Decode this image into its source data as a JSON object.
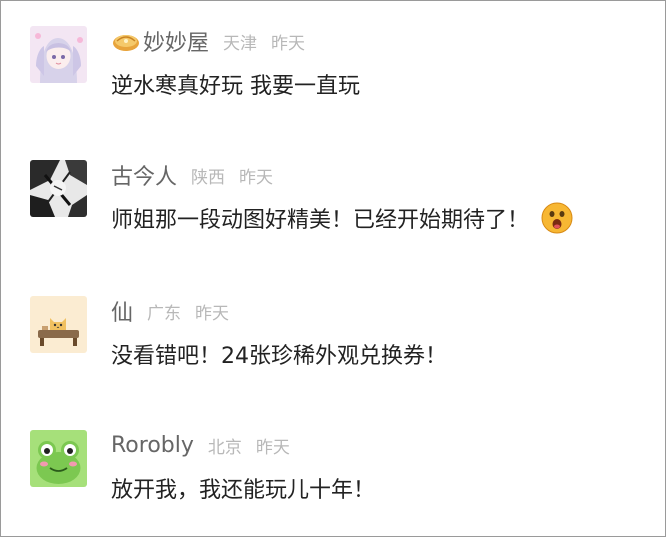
{
  "comments": [
    {
      "username": "妙妙屋",
      "location": "天津",
      "time": "昨天",
      "text": "逆水寒真好玩 我要一直玩",
      "avatar_icon": "anime-girl-avatar",
      "badge_icon": "gold-badge-icon"
    },
    {
      "username": "古今人",
      "location": "陕西",
      "time": "昨天",
      "text": "师姐那一段动图好精美！已经开始期待了！",
      "avatar_icon": "ink-sketch-avatar",
      "emoji_icon": "surprised-face-emoji"
    },
    {
      "username": "仙",
      "location": "广东",
      "time": "昨天",
      "text": "没看错吧！24张珍稀外观兑换券！",
      "avatar_icon": "cat-avatar"
    },
    {
      "username": "Rorobly",
      "location": "北京",
      "time": "昨天",
      "text": "放开我，我还能玩儿十年！",
      "avatar_icon": "frog-avatar"
    }
  ],
  "colors": {
    "username": "#666666",
    "meta": "#b8b8b8",
    "text": "#222222",
    "border": "#9a9a9a"
  }
}
